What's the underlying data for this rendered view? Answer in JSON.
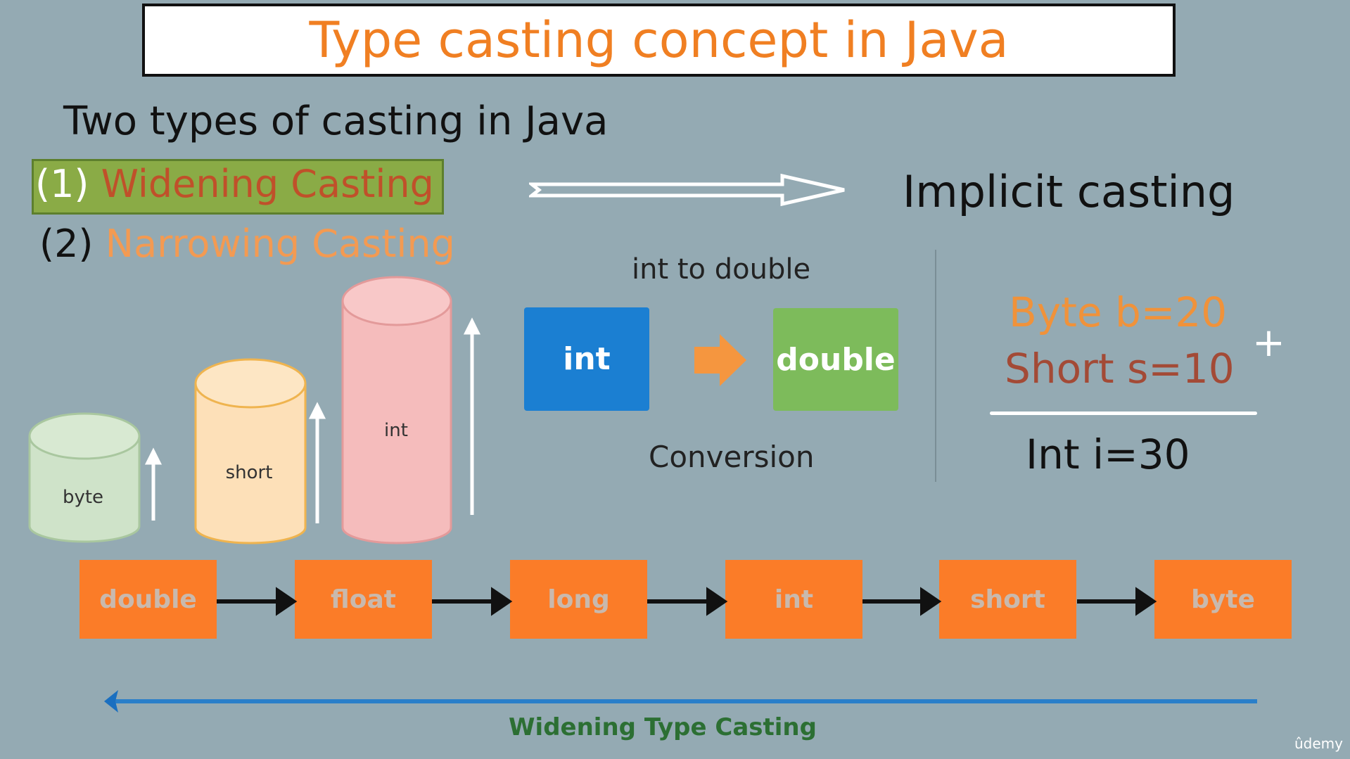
{
  "title": "Type casting  concept  in Java",
  "subtitle": "Two types of casting in Java",
  "types": [
    {
      "num": "(1)",
      "label": "Widening Casting"
    },
    {
      "num": "(2)",
      "label": "Narrowing Casting"
    }
  ],
  "implicit": "Implicit casting",
  "conversion": {
    "caption": "int to double",
    "from": "int",
    "to": "double",
    "label": "Conversion"
  },
  "cylinders": [
    "byte",
    "short",
    "int"
  ],
  "example": {
    "line1": "Byte  b=20",
    "line2": "Short s=10",
    "op": "+",
    "result": "Int i=30"
  },
  "chain": [
    "double",
    "float",
    "long",
    "int",
    "short",
    "byte"
  ],
  "widening_type": "Widening Type Casting",
  "watermark": "ûdemy",
  "colors": {
    "background": "#94aab3",
    "orange": "#fb7c28",
    "blue": "#1b7fd2",
    "green": "#7dbb5b"
  }
}
